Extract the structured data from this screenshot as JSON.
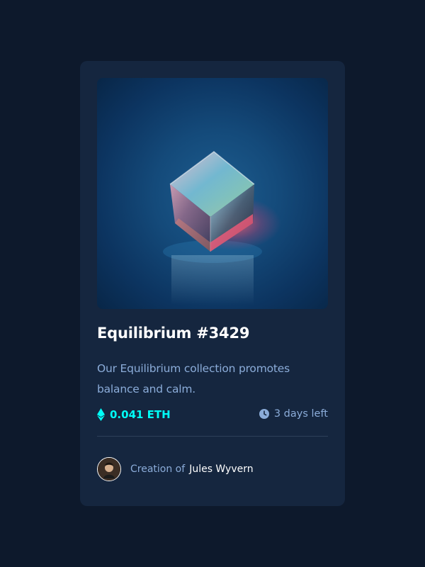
{
  "card": {
    "image_alt": "Equilibrium NFT cube artwork",
    "title": "Equilibrium #3429",
    "description": "Our Equilibrium collection promotes balance and calm.",
    "price": "0.041 ETH",
    "time_left": "3 days left",
    "creator_prefix": "Creation of",
    "creator_name": "Jules Wyvern"
  },
  "icons": {
    "price": "ethereum-icon",
    "time": "clock-icon",
    "avatar": "user-avatar"
  },
  "colors": {
    "page_bg": "#0d192c",
    "card_bg": "#15263f",
    "cyan": "#00fff8",
    "soft_blue": "#8bacd9",
    "white": "#ffffff",
    "divider": "#2e405a"
  }
}
